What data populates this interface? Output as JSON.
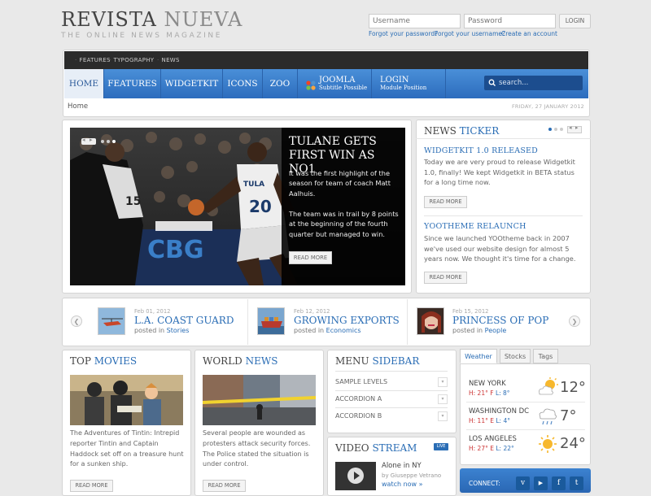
{
  "header": {
    "logo_main": "REVISTA",
    "logo_light": "NUEVA",
    "tagline": "THE ONLINE NEWS MAGAZINE",
    "login": {
      "username_placeholder": "Username",
      "password_placeholder": "Password",
      "button": "LOGIN",
      "forgot_password": "Forgot your password?",
      "forgot_username": "Forgot your username?",
      "create_account": "Create an account"
    }
  },
  "toolbar": {
    "items": [
      "FEATURES",
      "TYPOGRAPHY",
      "NEWS"
    ]
  },
  "menu": {
    "items": [
      "HOME",
      "FEATURES",
      "WIDGETKIT",
      "ICONS",
      "ZOO"
    ],
    "joomla": {
      "title": "JOOMLA",
      "subtitle": "Subtitle Possible"
    },
    "login": {
      "title": "LOGIN",
      "subtitle": "Module Position"
    },
    "search_placeholder": "search..."
  },
  "breadcrumb": {
    "home": "Home",
    "date": "FRIDAY, 27 JANUARY 2012"
  },
  "slideshow": {
    "title": "TULANE GETS FIRST WIN AS NO1",
    "paragraph1": "It was the first highlight of the season for team of coach Matt Aalhuis.",
    "paragraph2": "The team was in trail by 8 points at the beginning of the fourth quarter but managed to win.",
    "button": "READ MORE",
    "image_text": {
      "jersey1": "TULANE",
      "number": "20",
      "number2": "15"
    }
  },
  "ticker": {
    "title": "NEWS",
    "title_accent": "TICKER",
    "items": [
      {
        "heading": "WIDGETKIT 1.0 RELEASED",
        "text": "Today we are very proud to release Widgetkit 1.0, finally! We kept Widgetkit in BETA status for a long time now.",
        "button": "READ MORE"
      },
      {
        "heading": "YOOTHEME RELAUNCH",
        "text": "Since we launched YOOtheme back in 2007 we've used our website design for almost 5 years now. We thought it's time for a change.",
        "button": "READ MORE"
      }
    ]
  },
  "carousel": {
    "items": [
      {
        "date": "Feb 01, 2012",
        "title": "L.A. COAST GUARD",
        "posted": "posted in",
        "category": "Stories"
      },
      {
        "date": "Feb 12, 2012",
        "title": "GROWING EXPORTS",
        "posted": "posted in",
        "category": "Economics"
      },
      {
        "date": "Feb 15, 2012",
        "title": "PRINCESS OF POP",
        "posted": "posted in",
        "category": "People"
      }
    ]
  },
  "top_movies": {
    "title": "TOP",
    "title_accent": "MOVIES",
    "text": "The Adventures of Tintin: Intrepid reporter Tintin and Captain Haddock set off on a treasure hunt for a sunken ship.",
    "button": "READ MORE"
  },
  "world_news": {
    "title": "WORLD",
    "title_accent": "NEWS",
    "text": "Several people are wounded as protesters attack security forces. The Police stated the situation is under control.",
    "button": "READ MORE"
  },
  "menu_sidebar": {
    "title": "MENU",
    "title_accent": "SIDEBAR",
    "items": [
      "SAMPLE LEVELS",
      "ACCORDION A",
      "ACCORDION B"
    ]
  },
  "video_stream": {
    "title": "VIDEO",
    "title_accent": "STREAM",
    "badge": "LIVE",
    "item_title": "Alone in NY",
    "item_author": "by Giuseppe Vetrano",
    "item_link": "watch now »"
  },
  "weather": {
    "tabs": [
      "Weather",
      "Stocks",
      "Tags"
    ],
    "cities": [
      {
        "name": "NEW YORK",
        "high": "H: 21° F",
        "low": "L: 8°",
        "temp": "12°",
        "icon": "partly-sunny-icon"
      },
      {
        "name": "WASHINGTON DC",
        "high": "H: 11° E",
        "low": "L: 4°",
        "temp": "7°",
        "icon": "rain-cloud-icon"
      },
      {
        "name": "LOS ANGELES",
        "high": "H: 27° E",
        "low": "L: 22°",
        "temp": "24°",
        "icon": "sun-icon"
      }
    ]
  },
  "connect": {
    "label": "CONNECT:",
    "icons": [
      "v",
      "▶",
      "f",
      "t"
    ]
  },
  "colors": {
    "accent": "#2a6db5",
    "menubar": "#3a7dcc",
    "high": "#cc3333"
  }
}
